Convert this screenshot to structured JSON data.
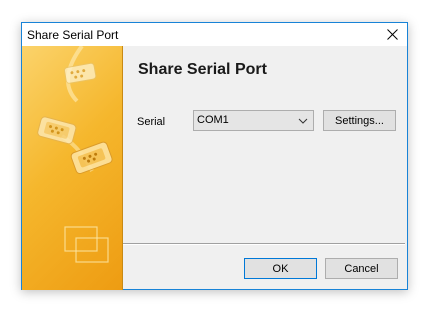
{
  "window": {
    "title": "Share Serial Port"
  },
  "icons": {
    "close": "close-icon",
    "connector": "serial-connector-icon",
    "dropdown": "chevron-down-icon",
    "windows": "overlapping-windows-icon"
  },
  "content": {
    "heading": "Share Serial Port",
    "serial_label": "Serial",
    "serial_value": "COM1",
    "settings_button": "Settings..."
  },
  "footer": {
    "ok_button": "OK",
    "cancel_button": "Cancel"
  },
  "colors": {
    "window_border": "#1883d7",
    "side_panel": "#f5b72d",
    "ok_border": "#0078d7"
  }
}
